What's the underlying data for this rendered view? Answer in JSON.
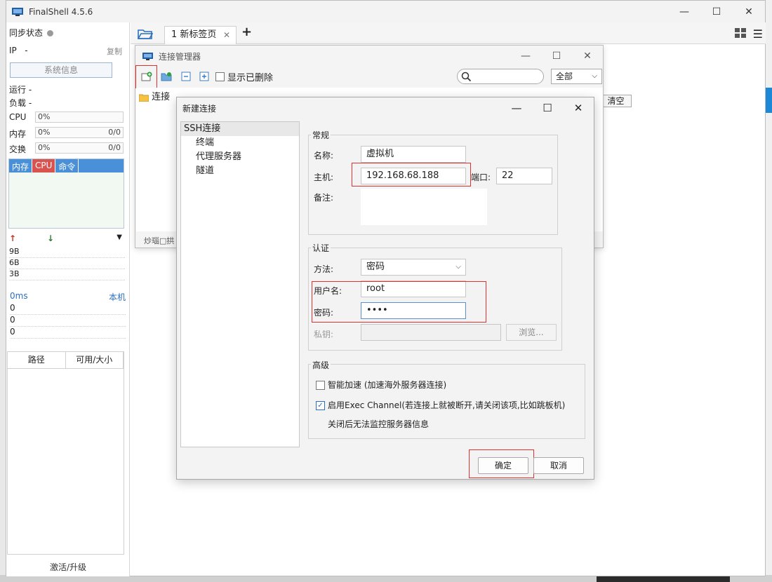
{
  "app": {
    "title": "FinalShell 4.5.6"
  },
  "left": {
    "sync_label": "同步状态",
    "ip_label": "IP",
    "ip_value": "-",
    "copy": "复制",
    "sysinfo": "系统信息",
    "run_label": "运行 -",
    "load_label": "负载 -",
    "cpu_label": "CPU",
    "cpu_value": "0%",
    "mem_label": "内存",
    "mem_value": "0%",
    "mem_right": "0/0",
    "swap_label": "交换",
    "swap_value": "0%",
    "swap_right": "0/0",
    "proc_headers": [
      "内存",
      "CPU",
      "命令"
    ],
    "net_values": [
      "9B",
      "6B",
      "3B"
    ],
    "ping_label": "0ms",
    "ping_right": "本机",
    "ping_values": [
      "0",
      "0",
      "0"
    ],
    "file_headers": [
      "路径",
      "可用/大小"
    ],
    "activate": "激活/升级"
  },
  "tabs": {
    "active_tab": "1 新标签页",
    "add": "+",
    "clear": "清空"
  },
  "conn_manager": {
    "title": "连接管理器",
    "show_deleted": "显示已删除",
    "filter": "全部",
    "tree_root": "连接",
    "status": "炒瑙□拱"
  },
  "new_conn": {
    "title": "新建连接",
    "tree": [
      "SSH连接",
      "终端",
      "代理服务器",
      "隧道"
    ],
    "general": {
      "legend": "常规",
      "name_label": "名称:",
      "name_value": "虚拟机",
      "host_label": "主机:",
      "host_value": "192.168.68.188",
      "port_label": "端口:",
      "port_value": "22",
      "note_label": "备注:"
    },
    "auth": {
      "legend": "认证",
      "method_label": "方法:",
      "method_value": "密码",
      "user_label": "用户名:",
      "user_value": "root",
      "pass_label": "密码:",
      "pass_value": "••••",
      "key_label": "私钥:",
      "browse": "浏览..."
    },
    "advanced": {
      "legend": "高级",
      "smart_accel": "智能加速 (加速海外服务器连接)",
      "smart_accel_checked": false,
      "exec_channel": "启用Exec Channel(若连接上就被断开,请关闭该项,比如跳板机)",
      "exec_channel_checked": true,
      "exec_note": "关闭后无法监控服务器信息"
    },
    "ok": "确定",
    "cancel": "取消"
  }
}
